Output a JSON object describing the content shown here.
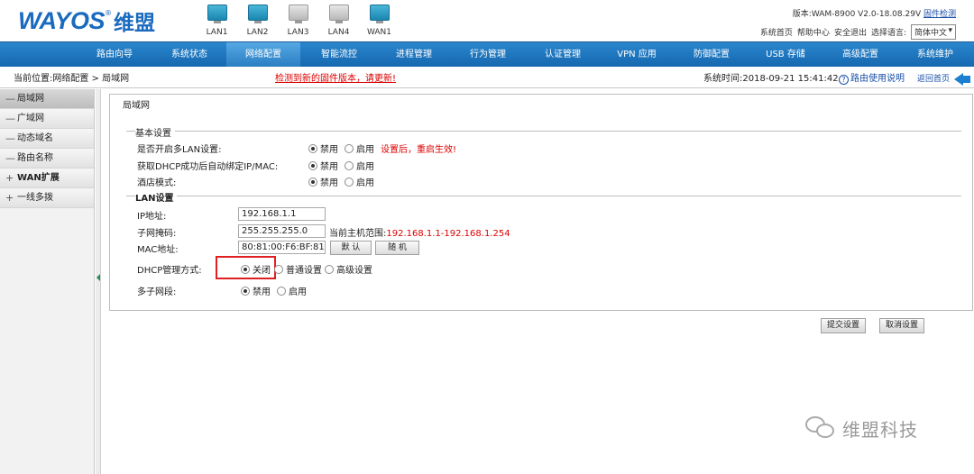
{
  "header": {
    "logo_en": "WAYOS",
    "logo_reg": "®",
    "logo_cn": "维盟",
    "ports": [
      {
        "label": "LAN1",
        "state": "active"
      },
      {
        "label": "LAN2",
        "state": "active"
      },
      {
        "label": "LAN3",
        "state": "inactive"
      },
      {
        "label": "LAN4",
        "state": "inactive"
      },
      {
        "label": "WAN1",
        "state": "active"
      }
    ],
    "version_text": "版本:WAM-8900 V2.0-18.08.29V",
    "firmware_check": "固件检测",
    "links": {
      "home": "系统首页",
      "help_center": "帮助中心",
      "logout": "安全退出",
      "choose_lang": "选择语言:"
    },
    "lang_value": "简体中文",
    "lang_arrow": "▾"
  },
  "nav": {
    "items": [
      "路由向导",
      "系统状态",
      "网络配置",
      "智能流控",
      "进程管理",
      "行为管理",
      "认证管理",
      "VPN 应用",
      "防御配置",
      "USB 存储",
      "高级配置",
      "系统维护"
    ],
    "active_index": 2
  },
  "crumbbar": {
    "crumb": "当前位置:网络配置 > 局域网",
    "fw_alert": "检测到新的固件版本，请更新!",
    "system_time": "系统时间:2018-09-21 15:41:42",
    "help_icon": "?",
    "help_text": "路由使用说明",
    "home_text": "返回首页"
  },
  "sidebar": {
    "items": [
      {
        "mark": "—",
        "label": "局域网",
        "active": true,
        "bold": false
      },
      {
        "mark": "—",
        "label": "广域网",
        "active": false,
        "bold": false
      },
      {
        "mark": "—",
        "label": "动态域名",
        "active": false,
        "bold": false
      },
      {
        "mark": "—",
        "label": "路由名称",
        "active": false,
        "bold": false
      },
      {
        "mark": "+",
        "label": "WAN扩展",
        "active": false,
        "bold": true
      },
      {
        "mark": "+",
        "label": "一线多拨",
        "active": false,
        "bold": false
      }
    ]
  },
  "panel": {
    "title": "局域网",
    "basic": {
      "legend": "基本设置",
      "multi_lan": {
        "label": "是否开启多LAN设置:",
        "options": [
          "禁用",
          "启用"
        ],
        "selected": 0,
        "note": "设置后，重启生效!"
      },
      "dhcp_bind": {
        "label": "获取DHCP成功后自动绑定IP/MAC:",
        "options": [
          "禁用",
          "启用"
        ],
        "selected": 0
      },
      "hotel_mode": {
        "label": "酒店模式:",
        "options": [
          "禁用",
          "启用"
        ],
        "selected": 0
      }
    },
    "lan": {
      "legend": "LAN设置",
      "ip": {
        "label": "IP地址:",
        "value": "192.168.1.1"
      },
      "mask": {
        "label": "子网掩码:",
        "value": "255.255.255.0",
        "range_label": "当前主机范围:",
        "range_value": "192.168.1.1-192.168.1.254"
      },
      "mac": {
        "label": "MAC地址:",
        "value": "80:81:00:F6:BF:81",
        "default_btn": "默 认",
        "random_btn": "随 机"
      },
      "dhcp_mode": {
        "label": "DHCP管理方式:",
        "options": [
          "关闭",
          "普通设置",
          "高级设置"
        ],
        "selected": 0
      },
      "multi_subnet": {
        "label": "多子网段:",
        "options": [
          "禁用",
          "启用"
        ],
        "selected": 0
      }
    }
  },
  "actions": {
    "submit": "提交设置",
    "cancel": "取消设置"
  },
  "watermark": {
    "text": "维盟科技"
  }
}
